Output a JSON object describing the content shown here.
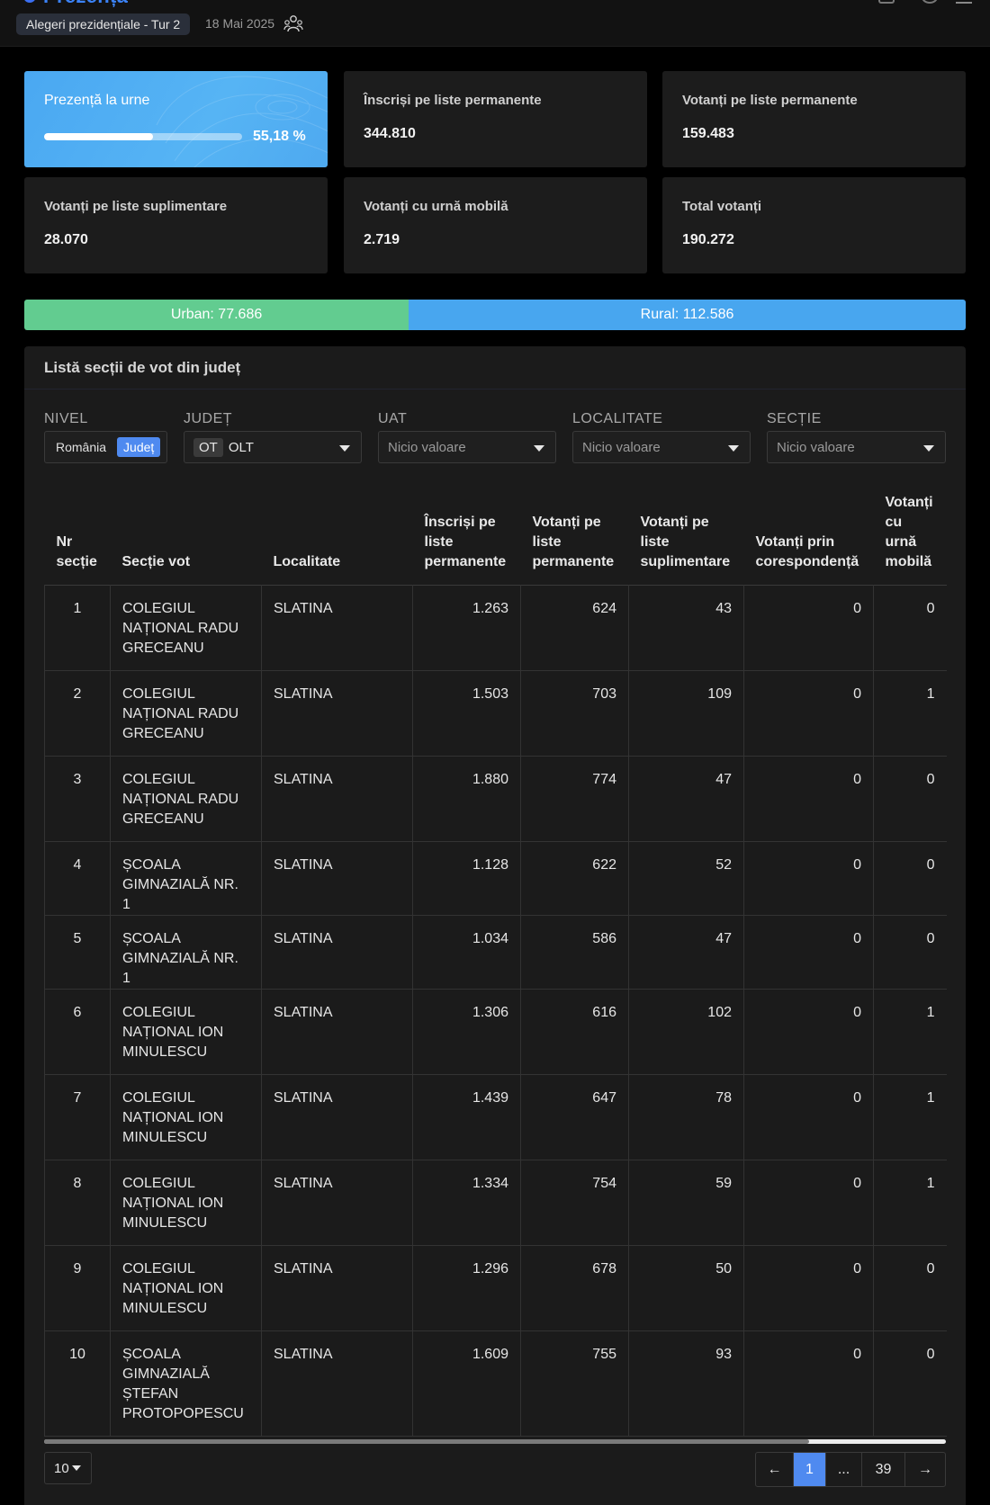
{
  "header": {
    "logo_text": "Prezență",
    "election_badge": "Alegeri prezidențiale - Tur 2",
    "date": "18 Mai 2025"
  },
  "stats": {
    "turnout": {
      "label": "Prezență la urne",
      "percent_text": "55,18 %",
      "percent_value": 55.18
    },
    "cards": [
      {
        "label": "Înscriși pe liste permanente",
        "value": "344.810"
      },
      {
        "label": "Votanți pe liste permanente",
        "value": "159.483"
      },
      {
        "label": "Votanți pe liste suplimentare",
        "value": "28.070"
      },
      {
        "label": "Votanți cu urnă mobilă",
        "value": "2.719"
      },
      {
        "label": "Total votanți",
        "value": "190.272"
      }
    ]
  },
  "urban_rural": {
    "urban_label": "Urban: 77.686",
    "rural_label": "Rural: 112.586",
    "urban_value": 77686,
    "rural_value": 112586
  },
  "panel": {
    "title": "Listă secții de vot din județ",
    "filters": {
      "nivel": {
        "label": "NIVEL",
        "options": [
          "România",
          "Județ"
        ],
        "active": "Județ"
      },
      "judet": {
        "label": "JUDEȚ",
        "code": "OT",
        "value": "OLT"
      },
      "uat": {
        "label": "UAT",
        "placeholder": "Nicio valoare"
      },
      "localitate": {
        "label": "LOCALITATE",
        "placeholder": "Nicio valoare"
      },
      "sectie": {
        "label": "SECȚIE",
        "placeholder": "Nicio valoare"
      }
    },
    "table": {
      "headers": [
        "Nr secție",
        "Secție vot",
        "Localitate",
        "Înscriși pe liste permanente",
        "Votanți pe liste permanente",
        "Votanți pe liste suplimentare",
        "Votanți prin corespondență",
        "Votanți cu urnă mobilă"
      ],
      "rows": [
        [
          "1",
          "COLEGIUL NAȚIONAL RADU GRECEANU",
          "SLATINA",
          "1.263",
          "624",
          "43",
          "0",
          "0"
        ],
        [
          "2",
          "COLEGIUL NAȚIONAL RADU GRECEANU",
          "SLATINA",
          "1.503",
          "703",
          "109",
          "0",
          "1"
        ],
        [
          "3",
          "COLEGIUL NAȚIONAL RADU GRECEANU",
          "SLATINA",
          "1.880",
          "774",
          "47",
          "0",
          "0"
        ],
        [
          "4",
          "ȘCOALA GIMNAZIALĂ NR. 1",
          "SLATINA",
          "1.128",
          "622",
          "52",
          "0",
          "0"
        ],
        [
          "5",
          "ȘCOALA GIMNAZIALĂ NR. 1",
          "SLATINA",
          "1.034",
          "586",
          "47",
          "0",
          "0"
        ],
        [
          "6",
          "COLEGIUL NAȚIONAL ION MINULESCU",
          "SLATINA",
          "1.306",
          "616",
          "102",
          "0",
          "1"
        ],
        [
          "7",
          "COLEGIUL NAȚIONAL ION MINULESCU",
          "SLATINA",
          "1.439",
          "647",
          "78",
          "0",
          "1"
        ],
        [
          "8",
          "COLEGIUL NAȚIONAL ION MINULESCU",
          "SLATINA",
          "1.334",
          "754",
          "59",
          "0",
          "1"
        ],
        [
          "9",
          "COLEGIUL NAȚIONAL ION MINULESCU",
          "SLATINA",
          "1.296",
          "678",
          "50",
          "0",
          "0"
        ],
        [
          "10",
          "ȘCOALA GIMNAZIALĂ ȘTEFAN PROTOPOPESCU",
          "SLATINA",
          "1.609",
          "755",
          "93",
          "0",
          "0"
        ]
      ]
    },
    "pagination": {
      "page_size": "10",
      "prev": "←",
      "current": "1",
      "ellipsis": "...",
      "last": "39",
      "next": "→"
    }
  },
  "colors": {
    "accent": "#4f8af0",
    "turnout_card": "#4aa8f2",
    "urban": "#62cc90",
    "rural": "#48a6ef",
    "panel_bg": "#1b1b1b"
  },
  "icons": [
    "logo-icon",
    "fullscreen-icon",
    "settings-icon",
    "menu-icon",
    "people-icon",
    "dropdown-caret-icon"
  ]
}
